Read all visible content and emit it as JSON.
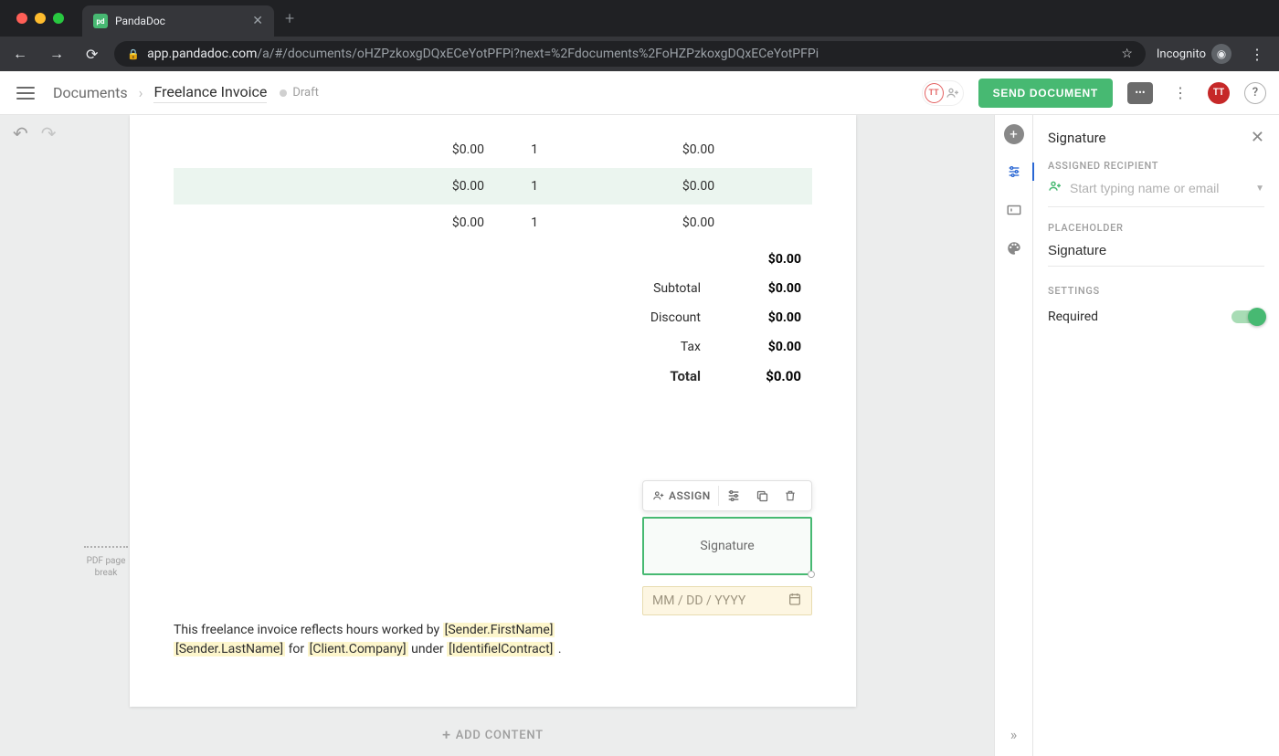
{
  "browser": {
    "tab_title": "PandaDoc",
    "url_domain": "app.pandadoc.com",
    "url_path": "/a/#/documents/oHZPzkoxgDQxECeYotPFPi?next=%2Fdocuments%2FoHZPzkoxgDQxECeYotPFPi",
    "incognito_label": "Incognito"
  },
  "header": {
    "breadcrumb_root": "Documents",
    "doc_title": "Freelance Invoice",
    "status": "Draft",
    "send_button": "SEND DOCUMENT",
    "user_initials": "TT"
  },
  "document": {
    "rows": [
      {
        "price": "$0.00",
        "qty": "1",
        "line_total": "$0.00"
      },
      {
        "price": "$0.00",
        "qty": "1",
        "line_total": "$0.00"
      },
      {
        "price": "$0.00",
        "qty": "1",
        "line_total": "$0.00"
      }
    ],
    "line_sum": "$0.00",
    "summary": {
      "subtotal_label": "Subtotal",
      "subtotal_value": "$0.00",
      "discount_label": "Discount",
      "discount_value": "$0.00",
      "tax_label": "Tax",
      "tax_value": "$0.00",
      "total_label": "Total",
      "total_value": "$0.00"
    },
    "assign_label": "ASSIGN",
    "signature_placeholder": "Signature",
    "date_placeholder": "MM / DD / YYYY",
    "footnote_prefix": "This freelance invoice reflects hours worked by ",
    "token_sender_first": "[Sender.FirstName]",
    "token_sender_last": "[Sender.LastName]",
    "footnote_for": " for ",
    "token_client_company": "[Client.Company]",
    "footnote_under": " under ",
    "token_contract": "[IdentifielContract]",
    "footnote_period": ".",
    "page_break_label_1": "PDF page",
    "page_break_label_2": "break",
    "add_content": "ADD CONTENT"
  },
  "panel": {
    "title": "Signature",
    "assigned_recipient_label": "ASSIGNED RECIPIENT",
    "recipient_placeholder": "Start typing name or email",
    "placeholder_label": "PLACEHOLDER",
    "placeholder_value": "Signature",
    "settings_label": "SETTINGS",
    "required_label": "Required"
  }
}
